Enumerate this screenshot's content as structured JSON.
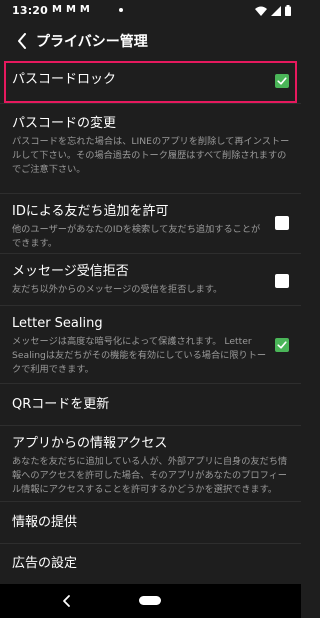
{
  "status_bar": {
    "time": "13:20",
    "notifications": [
      "M",
      "M",
      "M"
    ]
  },
  "header": {
    "title": "プライバシー管理"
  },
  "settings": [
    {
      "title": "パスコードロック",
      "checked": true
    },
    {
      "title": "パスコードの変更",
      "description": "パスコードを忘れた場合は、LINEのアプリを削除して再インストールして下さい。その場合過去のトーク履歴はすべて削除されますのでご注意下さい。"
    },
    {
      "title": "IDによる友だち追加を許可",
      "description": "他のユーザーがあなたのIDを検索して友だち追加することができます。",
      "checked": false
    },
    {
      "title": "メッセージ受信拒否",
      "description": "友だち以外からのメッセージの受信を拒否します。",
      "checked": false
    },
    {
      "title": "Letter Sealing",
      "description": "メッセージは高度な暗号化によって保護されます。 Letter Sealingは友だちがその機能を有効にしている場合に限りトークで利用できます。",
      "checked": true
    },
    {
      "title": "QRコードを更新"
    },
    {
      "title": "アプリからの情報アクセス",
      "description": "あなたを友だちに追加している人が、外部アプリに自身の友だち情報へのアクセスを許可した場合、そのアプリがあなたのプロフィール情報にアクセスすることを許可するかどうかを選択できます。"
    },
    {
      "title": "情報の提供"
    },
    {
      "title": "広告の設定"
    }
  ],
  "colors": {
    "background": "#1e1e1e",
    "checkbox_checked": "#4ab558",
    "highlight": "#e6195e"
  },
  "icons": {
    "back": "chevron-left-icon",
    "check": "check-icon"
  }
}
